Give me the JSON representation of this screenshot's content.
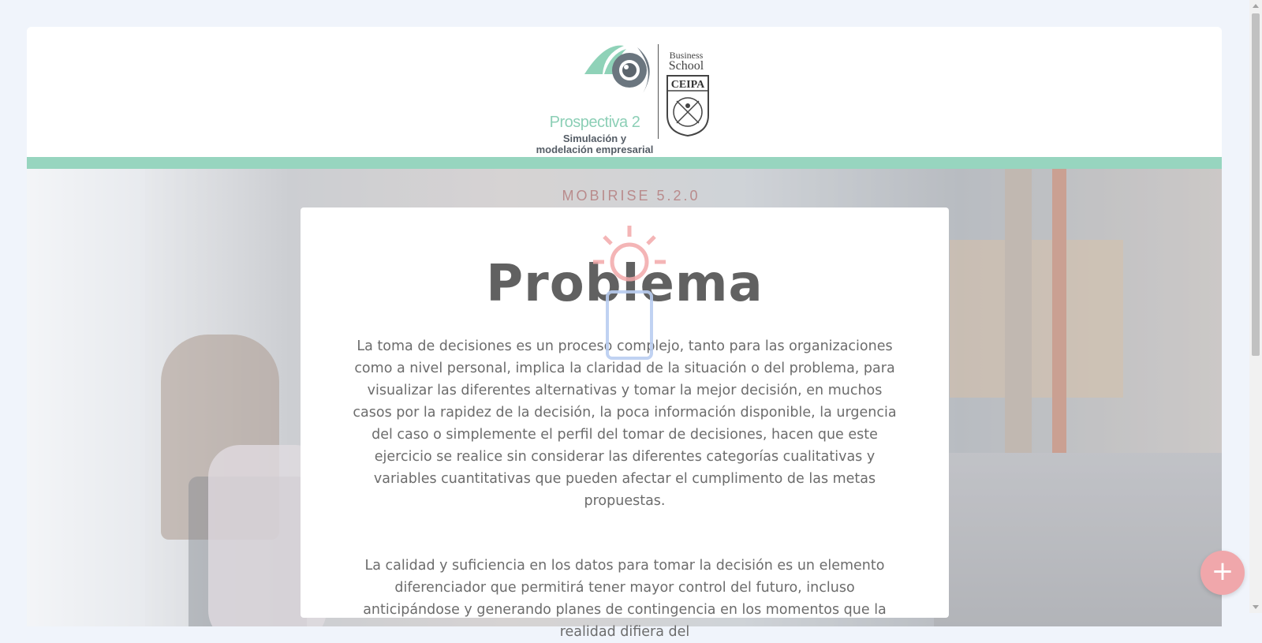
{
  "header": {
    "logo_title": "Prospectiva 2",
    "logo_subtitle_1": "Simulación y",
    "logo_subtitle_2": "modelación empresarial",
    "school_line_1": "Business",
    "school_line_2": "School",
    "school_name": "CEIPA"
  },
  "hero": {
    "badge": "MOBIRISE 5.2.0",
    "title": "Problema",
    "paragraph_1": "La toma de decisiones es un proceso complejo, tanto para las organizaciones como a nivel personal, implica la claridad de la situación o del problema, para visualizar las diferentes alternativas y tomar la mejor decisión, en muchos casos por la rapidez de la decisión, la poca información disponible, la urgencia del caso o simplemente el perfil del tomar de decisiones, hacen que este ejercicio se realice sin considerar las diferentes categorías cualitativas y variables cuantitativas que pueden afectar el cumplimento de las metas propuestas.",
    "paragraph_2": "La calidad y suficiencia en los datos para tomar la decisión es un elemento diferenciador que permitirá tener mayor control del futuro, incluso anticipándose y generando planes de contingencia en los momentos que la realidad difiera del"
  },
  "fab": {
    "label": "+"
  },
  "colors": {
    "mint": "#97d5bf",
    "fab": "#f0a7ab",
    "heading": "#616161",
    "badge": "#b98b8c"
  },
  "icons": [
    "eye-logo-icon",
    "ceipa-shield-icon",
    "sun-icon",
    "phone-icon",
    "plus-icon"
  ]
}
